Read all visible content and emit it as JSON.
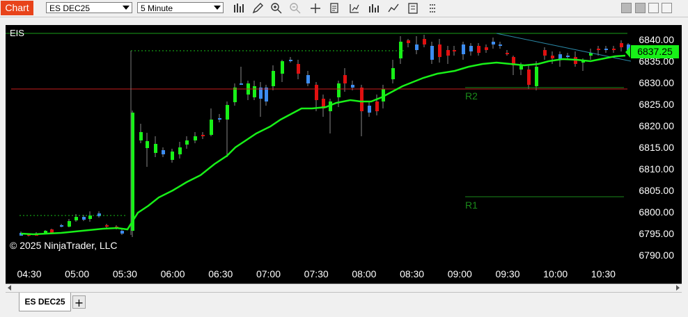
{
  "toolbar": {
    "chart_tab": "Chart",
    "instrument": "ES DEC25",
    "interval": "5 Minute",
    "icons": [
      "bars-type-icon",
      "draw-pencil-icon",
      "zoom-in-icon",
      "zoom-out-icon",
      "crosshair-icon",
      "data-box-icon",
      "indicators-icon",
      "strategy-icon",
      "drawing-tools-icon",
      "properties-icon",
      "more-icon"
    ]
  },
  "window_buttons": [
    "minimize-icon",
    "restore-icon",
    "maximize-icon",
    "close-icon"
  ],
  "chart": {
    "indicator_label": "EIS",
    "copyright": "© 2025 NinjaTrader, LLC",
    "last_price": "6837.25",
    "level_labels": {
      "r2": "R2",
      "r1": "R1"
    },
    "price_ticks": [
      "6840.00",
      "6835.00",
      "6830.00",
      "6825.00",
      "6820.00",
      "6815.00",
      "6810.00",
      "6805.00",
      "6800.00",
      "6795.00",
      "6790.00"
    ],
    "time_ticks": [
      "04:30",
      "05:00",
      "05:30",
      "06:00",
      "06:30",
      "07:00",
      "07:30",
      "08:00",
      "08:30",
      "09:00",
      "09:30",
      "10:00",
      "10:30"
    ],
    "colors": {
      "up": "#18f018",
      "down": "#e01010",
      "flat": "#3c8cf0",
      "ma": "#18f018",
      "r_line": "#c81e1e"
    }
  },
  "tabs": {
    "instrument_tab": "ES DEC25",
    "add_tab": "+"
  }
}
